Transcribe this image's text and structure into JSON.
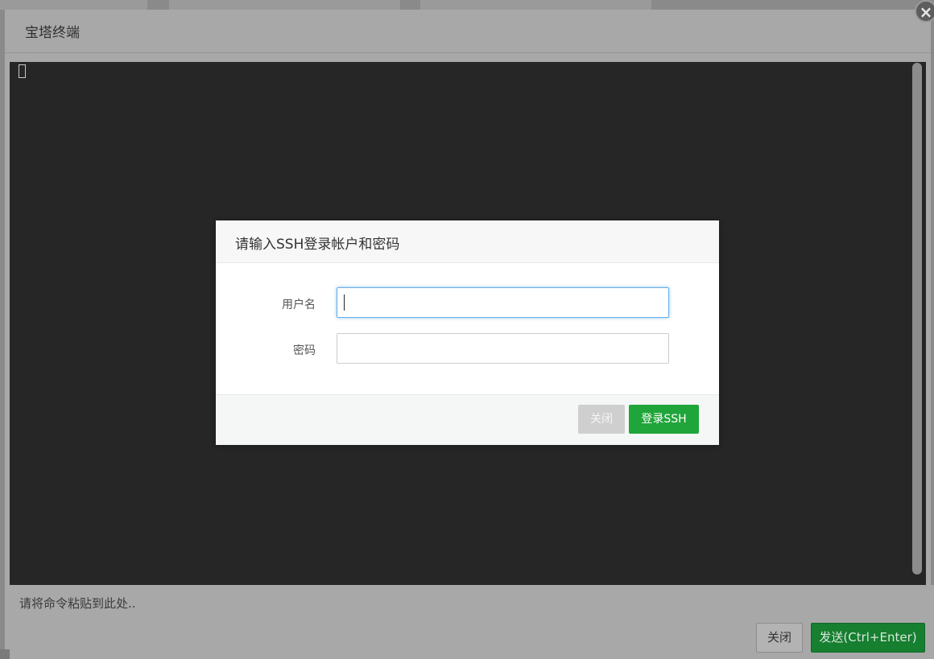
{
  "terminal": {
    "title": "宝塔终端",
    "close_icon": "×",
    "command_placeholder": "请将命令粘贴到此处..",
    "close_label": "关闭",
    "send_label": "发送(Ctrl+Enter)"
  },
  "login_dialog": {
    "title": "请输入SSH登录帐户和密码",
    "username_label": "用户名",
    "username_value": "",
    "password_label": "密码",
    "password_value": "",
    "cancel_label": "关闭",
    "login_label": "登录SSH"
  },
  "colors": {
    "login_button": "#20a53a",
    "send_button": "#167f30",
    "terminal_background": "#262626"
  }
}
